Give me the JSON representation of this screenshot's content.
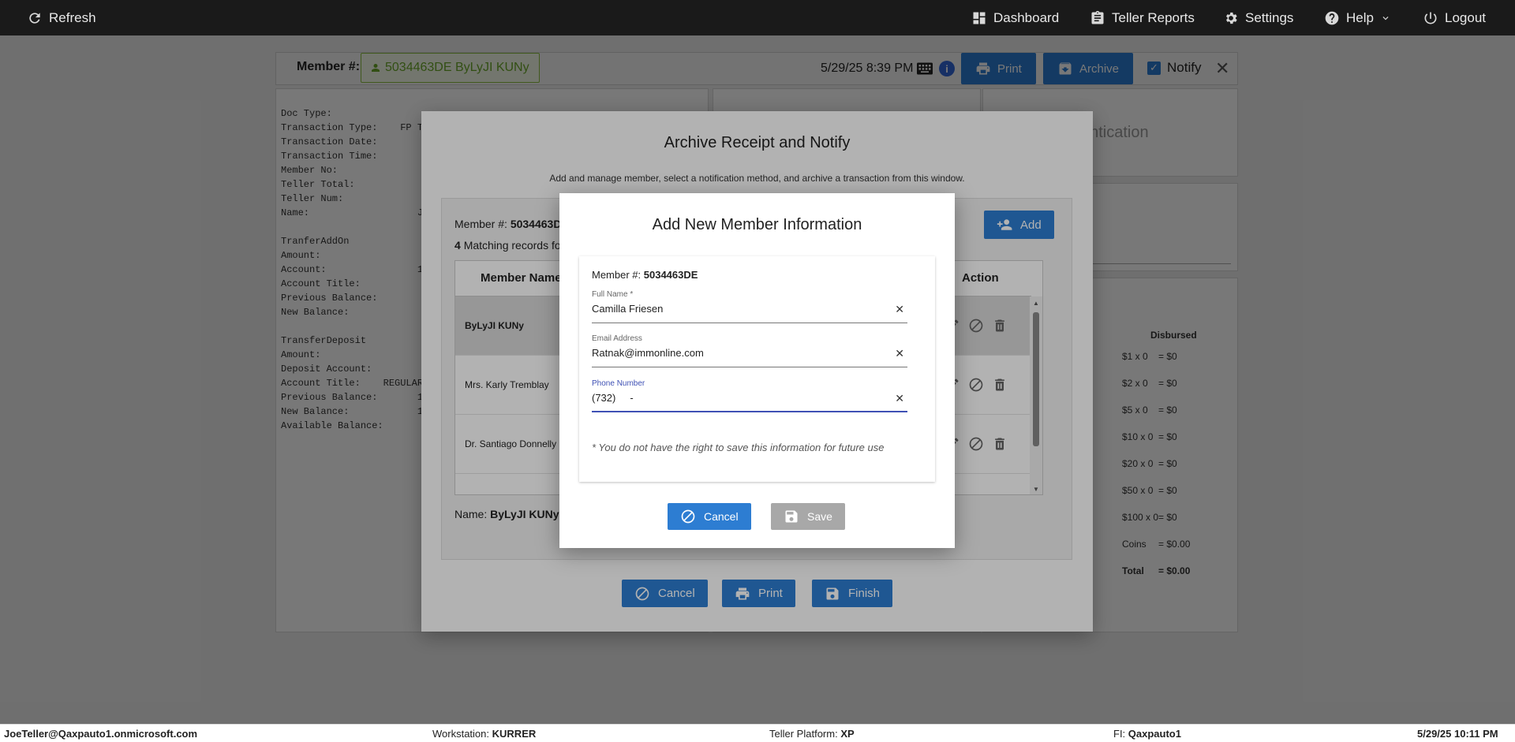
{
  "topbar": {
    "refresh": "Refresh",
    "dashboard": "Dashboard",
    "teller_reports": "Teller Reports",
    "settings": "Settings",
    "help": "Help",
    "logout": "Logout"
  },
  "header": {
    "member_label": "Member #:",
    "member_chip": "5034463DE ByLyJI KUNy",
    "datetime": "5/29/25 8:39 PM",
    "info": "i",
    "print": "Print",
    "archive": "Archive",
    "notify": "Notify",
    "notify_checked": true
  },
  "receipt": {
    "lines": [
      "Doc Type:",
      "Transaction Type:    FP TRA",
      "Transaction Date:",
      "Transaction Time:",
      "Member No:               5",
      "Teller Total:",
      "Teller Num:",
      "Name:                   Ja",
      "",
      "TranferAddOn",
      "Amount:",
      "Account:                1",
      "Account Title:",
      "Previous Balance:",
      "New Balance:",
      "",
      "TransferDeposit",
      "Amount:",
      "Deposit Account:",
      "Account Title:    REGULAR",
      "Previous Balance:       1",
      "New Balance:            1",
      "Available Balance:"
    ]
  },
  "right_panel": {
    "title_fragment": "entication",
    "disbursed_header": "Disbursed",
    "denoms": [
      {
        "label": "$1 x 0",
        "value": "= $0"
      },
      {
        "label": "$2 x 0",
        "value": "= $0"
      },
      {
        "label": "$5 x 0",
        "value": "= $0"
      },
      {
        "label": "$10 x 0",
        "value": "= $0"
      },
      {
        "label": "$20 x 0",
        "value": "= $0"
      },
      {
        "label": "$50 x 0",
        "value": "= $0"
      },
      {
        "label": "$100 x 0",
        "value": "= $0"
      },
      {
        "label": "Coins",
        "value": "= $0.00"
      },
      {
        "label": "Total",
        "value": "= $0.00"
      }
    ]
  },
  "archive_dialog": {
    "title": "Archive Receipt and Notify",
    "subtitle": "Add and manage member, select a notification method, and archive a transaction from this window.",
    "member_label": "Member #:",
    "member_value": "5034463D",
    "matching_count": "4",
    "matching_text": "Matching records fo",
    "add": "Add",
    "columns": [
      "Member Name",
      "Action"
    ],
    "rows": [
      "ByLyJI KUNy",
      "Mrs. Karly Tremblay",
      "Dr. Santiago Donnelly"
    ],
    "name_label": "Name:",
    "name_value": "ByLyJI KUNy",
    "cancel": "Cancel",
    "print": "Print",
    "finish": "Finish"
  },
  "add_member_dialog": {
    "title": "Add New Member Information",
    "member_label": "Member #:",
    "member_value": "5034463DE",
    "full_name_label": "Full Name *",
    "full_name_value": "Camilla Friesen",
    "email_label": "Email Address",
    "email_value": "Ratnak@immonline.com",
    "phone_label": "Phone Number",
    "phone_value": "(732)     -",
    "note": "* You do not have the right to save this information for future use",
    "cancel": "Cancel",
    "save": "Save"
  },
  "statusbar": {
    "user": "JoeTeller@Qaxpauto1.onmicrosoft.com",
    "workstation_label": "Workstation:",
    "workstation": "KURRER",
    "platform_label": "Teller Platform:",
    "platform": "XP",
    "fi_label": "FI:",
    "fi": "Qaxpauto1",
    "datetime": "5/29/25 10:11 PM"
  },
  "colors": {
    "accent": "#2d7dd2",
    "topbar": "#1a1a1a",
    "chip_green": "#6aa82a",
    "save_disabled": "#a8a8a8",
    "field_active": "#3f51b5"
  }
}
